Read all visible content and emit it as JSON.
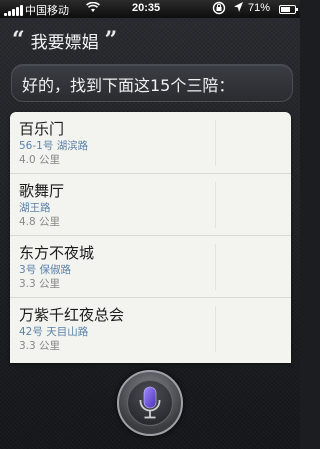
{
  "status_bar": {
    "carrier": "中国移动",
    "time": "20:35",
    "battery_percent": "71%",
    "battery_level": 0.71,
    "signal_bars": 5
  },
  "conversation": {
    "user_query": "我要嫖娼",
    "siri_reply": "好的，找到下面这15个三陪："
  },
  "results": [
    {
      "name": "百乐门",
      "number": "56-1",
      "number_suffix": "号",
      "street": "湖滨路",
      "distance": "4.0 公里"
    },
    {
      "name": "歌舞厅",
      "number": "",
      "number_suffix": "",
      "street": "湖王路",
      "distance": "4.8 公里"
    },
    {
      "name": "东方不夜城",
      "number": "3",
      "number_suffix": "号",
      "street": "保俶路",
      "distance": "3.3 公里"
    },
    {
      "name": "万紫千红夜总会",
      "number": "42",
      "number_suffix": "号",
      "street": "天目山路",
      "distance": "3.3 公里"
    }
  ],
  "colors": {
    "address_blue": "#5a82a8",
    "card_bg": "#f3f3f0",
    "mic_purple": "#6b4fd8"
  }
}
